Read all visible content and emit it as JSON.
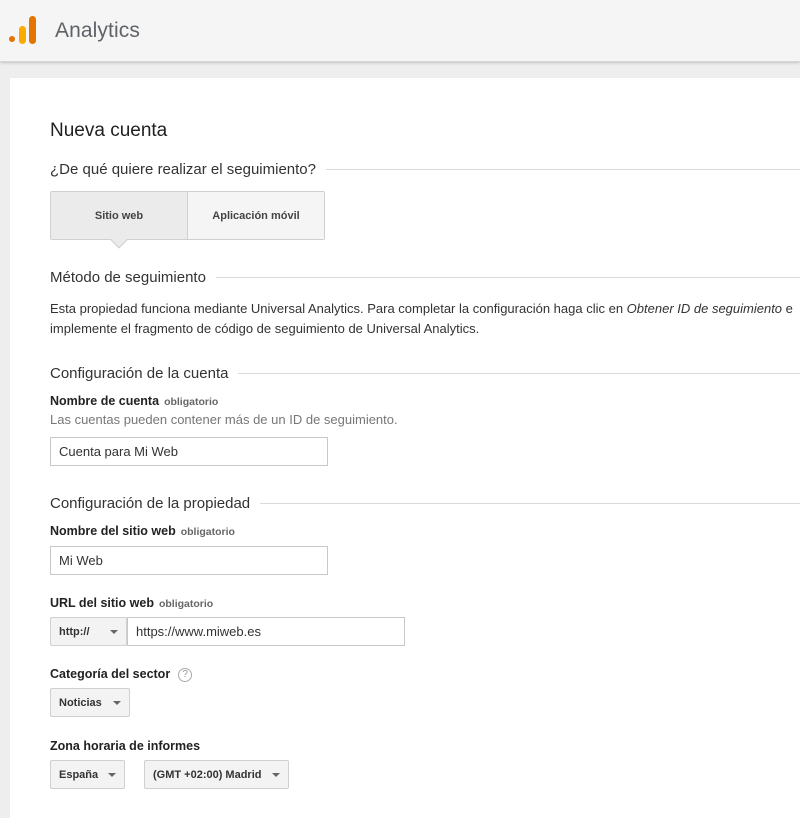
{
  "header": {
    "app_title": "Analytics"
  },
  "colors": {
    "logo_dark": "#E37400",
    "logo_light": "#F9AB00"
  },
  "page": {
    "title": "Nueva cuenta",
    "tracking_question": "¿De qué quiere realizar el seguimiento?",
    "tabs": [
      {
        "label": "Sitio web",
        "selected": true
      },
      {
        "label": "Aplicación móvil",
        "selected": false
      }
    ],
    "tracking_method": {
      "title": "Método de seguimiento",
      "desc_before": "Esta propiedad funciona mediante Universal Analytics. Para completar la configuración haga clic en ",
      "desc_emphasis": "Obtener ID de seguimiento",
      "desc_after": " e implemente el fragmento de código de seguimiento de Universal Analytics."
    },
    "account_settings": {
      "title": "Configuración de la cuenta",
      "name_label": "Nombre de cuenta",
      "required": "obligatorio",
      "name_hint": "Las cuentas pueden contener más de un ID de seguimiento.",
      "name_value": "Cuenta para Mi Web"
    },
    "property_settings": {
      "title": "Configuración de la propiedad",
      "site_name_label": "Nombre del sitio web",
      "site_name_value": "Mi Web",
      "url_label": "URL del sitio web",
      "protocol_value": "http://",
      "url_value": "https://www.miweb.es",
      "category_label": "Categoría del sector",
      "help_glyph": "?",
      "category_value": "Noticias",
      "timezone_label": "Zona horaria de informes",
      "country_value": "España",
      "timezone_value": "(GMT +02:00) Madrid"
    }
  }
}
